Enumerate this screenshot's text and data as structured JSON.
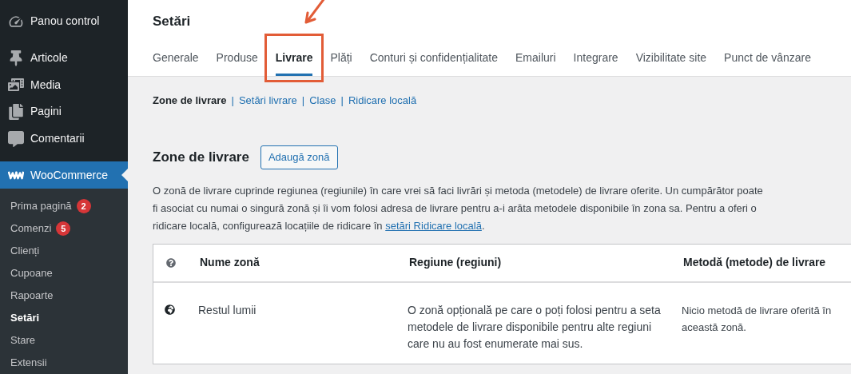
{
  "sidebar": {
    "items": [
      {
        "kind": "dashboard",
        "label": "Panou control",
        "selected": false
      },
      {
        "kind": "pin",
        "label": "Articole",
        "selected": false
      },
      {
        "kind": "media",
        "label": "Media",
        "selected": false
      },
      {
        "kind": "pages",
        "label": "Pagini",
        "selected": false
      },
      {
        "kind": "comments",
        "label": "Comentarii",
        "selected": false
      },
      {
        "kind": "woo",
        "label": "WooCommerce",
        "selected": true
      }
    ],
    "submenu": [
      {
        "label": "Prima pagină",
        "badge": "2",
        "selected": false
      },
      {
        "label": "Comenzi",
        "badge": "5",
        "selected": false
      },
      {
        "label": "Clienți",
        "selected": false
      },
      {
        "label": "Cupoane",
        "selected": false
      },
      {
        "label": "Rapoarte",
        "selected": false
      },
      {
        "label": "Setări",
        "selected": true
      },
      {
        "label": "Stare",
        "selected": false
      },
      {
        "label": "Extensii",
        "selected": false
      }
    ]
  },
  "page_title": "Setări",
  "tabs": [
    {
      "label": "Generale",
      "selected": false,
      "annotated": false
    },
    {
      "label": "Produse",
      "selected": false,
      "annotated": false
    },
    {
      "label": "Livrare",
      "selected": true,
      "annotated": true
    },
    {
      "label": "Plăți",
      "selected": false,
      "annotated": false
    },
    {
      "label": "Conturi și confidențialitate",
      "selected": false,
      "annotated": false
    },
    {
      "label": "Emailuri",
      "selected": false,
      "annotated": false
    },
    {
      "label": "Integrare",
      "selected": false,
      "annotated": false
    },
    {
      "label": "Vizibilitate site",
      "selected": false,
      "annotated": false
    },
    {
      "label": "Punct de vânzare",
      "selected": false,
      "annotated": false
    }
  ],
  "subnav": [
    {
      "label": "Zone de livrare",
      "selected": true
    },
    {
      "separator": "|",
      "label": "Setări livrare",
      "selected": false
    },
    {
      "separator": "|",
      "label": "Clase",
      "selected": false
    },
    {
      "separator": "|",
      "label": "Ridicare locală",
      "selected": false
    }
  ],
  "section": {
    "heading": "Zone de livrare",
    "button": "Adaugă zonă",
    "description": {
      "text": "O zonă de livrare cuprinde regiunea (regiunile) în care vrei să faci livrări și metoda (metodele) de livrare oferite. Un cumpărător poate fi asociat cu numai o singură zonă și îi vom folosi adresa de livrare pentru a-i arăta metodele disponibile în zona sa. Pentru a oferi o ridicare locală, configurează locațiile de ridicare în ",
      "link": "setări Ridicare locală",
      "after": "."
    }
  },
  "table": {
    "columns": [
      "Nume zonă",
      "Regiune (regiuni)",
      "Metodă (metode) de livrare"
    ],
    "rows": [
      {
        "name": "Restul lumii",
        "region": "O zonă opțională pe care o poți folosi pentru a seta metodele de livrare disponibile pentru alte regiuni care nu au fost enumerate mai sus.",
        "methods": "Nicio metodă de livrare oferită în această zonă."
      }
    ]
  }
}
